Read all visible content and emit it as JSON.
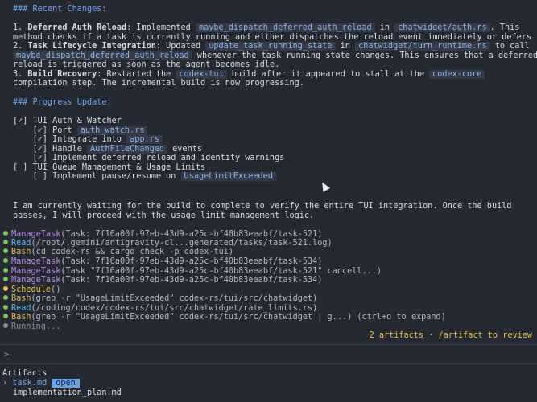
{
  "recent": {
    "header": "### Recent Changes:",
    "item1_prefix": "1. ",
    "item1_title": "Deferred Auth Reload",
    "item1_a": ": Implemented ",
    "item1_code1": "maybe_dispatch_deferred_auth_reload",
    "item1_b": " in ",
    "item1_code2": "chatwidget/auth.rs",
    "item1_c": ". This",
    "item1_line2": "method checks if a task is currently running and either dispatches the reload event immediately or defers it.",
    "item2_prefix": "2. ",
    "item2_title": "Task Lifecycle Integration",
    "item2_a": ": Updated ",
    "item2_code1": "update_task_running_state",
    "item2_b": " in ",
    "item2_code2": "chatwidget/turn_runtime.rs",
    "item2_c": " to call",
    "item2_code3": "maybe_dispatch_deferred_auth_reload",
    "item2_d": " whenever the task running state changes. This ensures that a deferred",
    "item2_line3": "reload is triggered as soon as the agent becomes idle.",
    "item3_prefix": "3. ",
    "item3_title": "Build Recovery",
    "item3_a": ": Restarted the ",
    "item3_code1": "codex-tui",
    "item3_b": " build after it appeared to stall at the ",
    "item3_code2": "codex-core",
    "item3_line2": "compilation step. The incremental build is now progressing."
  },
  "progress": {
    "header": "### Progress Update:",
    "l1": "[✓] TUI Auth & Watcher",
    "l2_a": "    [✓] Port ",
    "l2_code": "auth_watch.rs",
    "l3_a": "    [✓] Integrate into ",
    "l3_code": "app.rs",
    "l4_a": "    [✓] Handle ",
    "l4_code": "AuthFileChanged",
    "l4_b": " events",
    "l5": "    [✓] Implement deferred reload and identity warnings",
    "l6": "[ ] TUI Queue Management & Usage Limits",
    "l7_a": "    [ ] Implement pause/resume on ",
    "l7_code": "UsageLimitExceeded"
  },
  "status": {
    "line1": "I am currently waiting for the build to complete to verify the entire TUI integration. Once the build",
    "line2": "passes, I will proceed with the usage limit management logic."
  },
  "tools": [
    {
      "name": "ManageTask",
      "args": "(Task: 7f16a00f-97eb-43d9-a25c-bf40b83eeabf/task-521)"
    },
    {
      "name": "Read",
      "args": "(/root/.gemini/antigravity-cl...generated/tasks/task-521.log)"
    },
    {
      "name": "Bash",
      "args": "(cd codex-rs && cargo check -p codex-tui)"
    },
    {
      "name": "ManageTask",
      "args": "(Task: 7f16a00f-97eb-43d9-a25c-bf40b83eeabf/task-534)"
    },
    {
      "name": "ManageTask",
      "args": "(Task \"7f16a00f-97eb-43d9-a25c-bf40b83eeabf/task-521\" cancell...)"
    },
    {
      "name": "ManageTask",
      "args": "(Task: 7f16a00f-97eb-43d9-a25c-bf40b83eeabf/task-534)"
    },
    {
      "name": "Schedule",
      "args": "()"
    },
    {
      "name": "Bash",
      "args": "(grep -r \"UsageLimitExceeded\" codex-rs/tui/src/chatwidget)"
    },
    {
      "name": "Read",
      "args": "(/coding/codex/codex-rs/tui/src/chatwidget/rate_limits.rs)"
    },
    {
      "name": "Bash",
      "args": "(grep -r \"UsageLimitExceeded\" codex-rs/tui/src/chatwidget | g...)"
    }
  ],
  "expand_hint": " (ctrl+o to expand)",
  "running": "Running...",
  "artifacts_note": "2 artifacts · /artifact to review",
  "prompt": ">",
  "artifacts": {
    "title": "Artifacts",
    "item1_prefix": "› ",
    "item1": "task.md",
    "item1_badge": "open",
    "item2": "implementation_plan.md"
  },
  "colors": {
    "background": "#262932",
    "code_bg": "#363a46",
    "accent_blue": "#74a6e6",
    "status_green": "#7dc15e",
    "status_yellow": "#e6c54a"
  }
}
